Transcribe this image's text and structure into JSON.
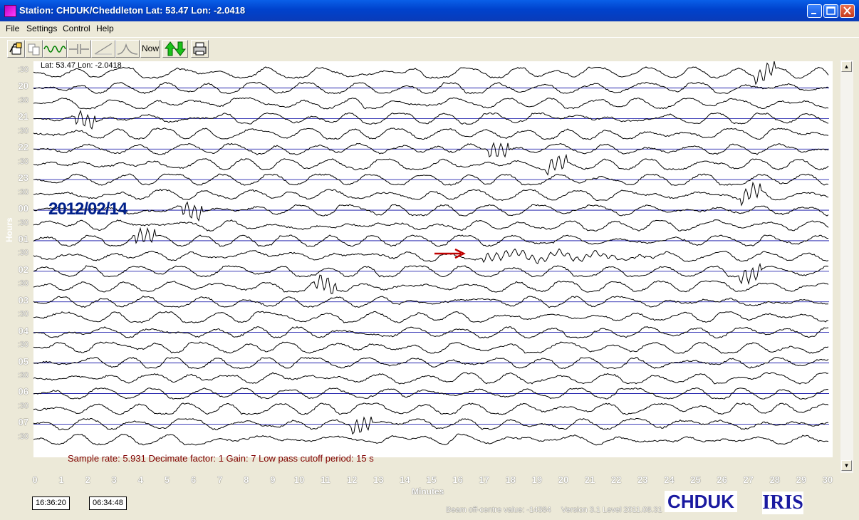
{
  "window": {
    "title": "Station: CHDUK/Cheddleton Lat: 53.47 Lon: -2.0418",
    "controls": [
      "minimize",
      "maximize",
      "close"
    ]
  },
  "menu": [
    "File",
    "Settings",
    "Control",
    "Help"
  ],
  "toolbar": {
    "now_label": "Now",
    "icons": [
      "open-file-icon",
      "copy-icon",
      "waveform-icon",
      "filter-icon",
      "slope-icon",
      "peak-icon",
      "now-button",
      "up-down-arrows-icon",
      "print-icon"
    ]
  },
  "plot": {
    "latlon": "Lat: 53.47 Lon: -2.0418",
    "date_label": "2012/02/14",
    "y_axis_title": "Hours",
    "y_labels": [
      ":30",
      "20",
      ":30",
      "21",
      ":30",
      "22",
      ":30",
      "23",
      ":30",
      "00",
      ":30",
      "01",
      ":30",
      "02",
      ":30",
      "03",
      ":30",
      "04",
      ":30",
      "05",
      ":30",
      "06",
      ":30",
      "07",
      ":30"
    ],
    "x_axis_title": "Minutes",
    "x_ticks": [
      "0",
      "1",
      "2",
      "3",
      "4",
      "5",
      "6",
      "7",
      "8",
      "9",
      "10",
      "11",
      "12",
      "13",
      "14",
      "15",
      "16",
      "17",
      "18",
      "19",
      "20",
      "21",
      "22",
      "23",
      "24",
      "25",
      "26",
      "27",
      "28",
      "29",
      "30"
    ],
    "info_text": "Sample rate: 5.931  Decimate factor: 1  Gain: 7  Low pass cutoff period: 15 s",
    "trace_color": "#000000",
    "hour_line_color": "#0000a0",
    "arrow_color": "#c00000"
  },
  "status": {
    "start_time": "16:36:20",
    "end_time": "06:34:48",
    "beam_text": "Beam off-centre value: -14384",
    "version_text": "Version 3.1 Level 2011.08.31",
    "station_logo": "CHDUK",
    "iris_logo": "IRIS"
  }
}
